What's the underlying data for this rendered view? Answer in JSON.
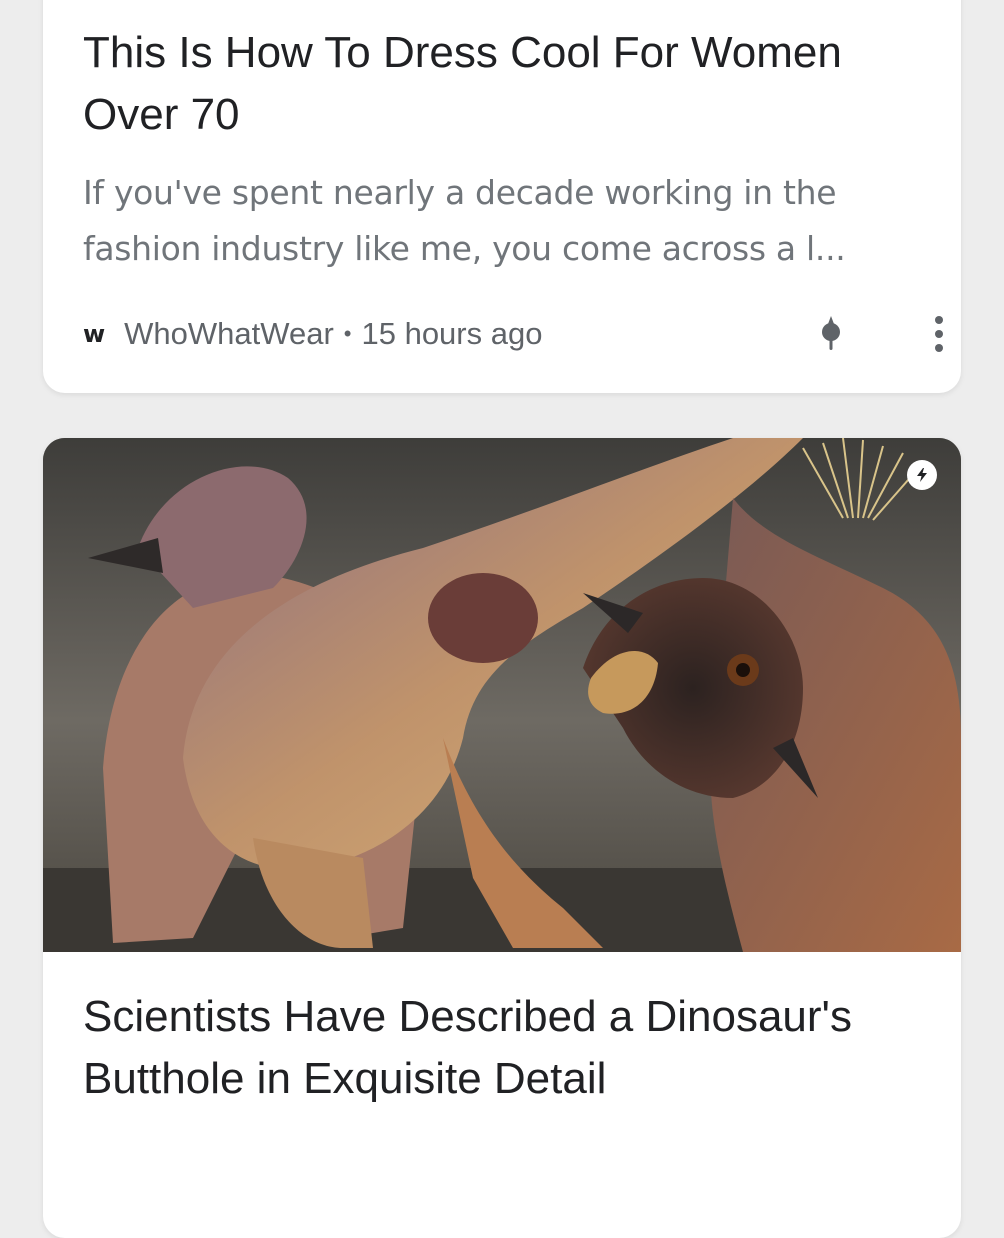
{
  "feed": {
    "cards": [
      {
        "title": "This Is How To Dress Cool For Women Over 70",
        "snippet": "If you've spent nearly a decade working in the fashion industry like me, you come across a l...",
        "source_logo": "w",
        "source": "WhoWhatWear",
        "separator": "•",
        "time": "15 hours ago"
      },
      {
        "image_alt_icon": "amp-lightning-icon",
        "title": "Scientists Have Described a Dinosaur's Butthole in Exquisite Detail"
      }
    ]
  },
  "icons": {
    "pin": "pin-icon",
    "more": "more-vert-icon",
    "amp": "amp-lightning-icon"
  },
  "colors": {
    "title": "#202124",
    "snippet": "#70757a",
    "meta": "#5f6368",
    "background": "#ededed",
    "card": "#ffffff"
  }
}
